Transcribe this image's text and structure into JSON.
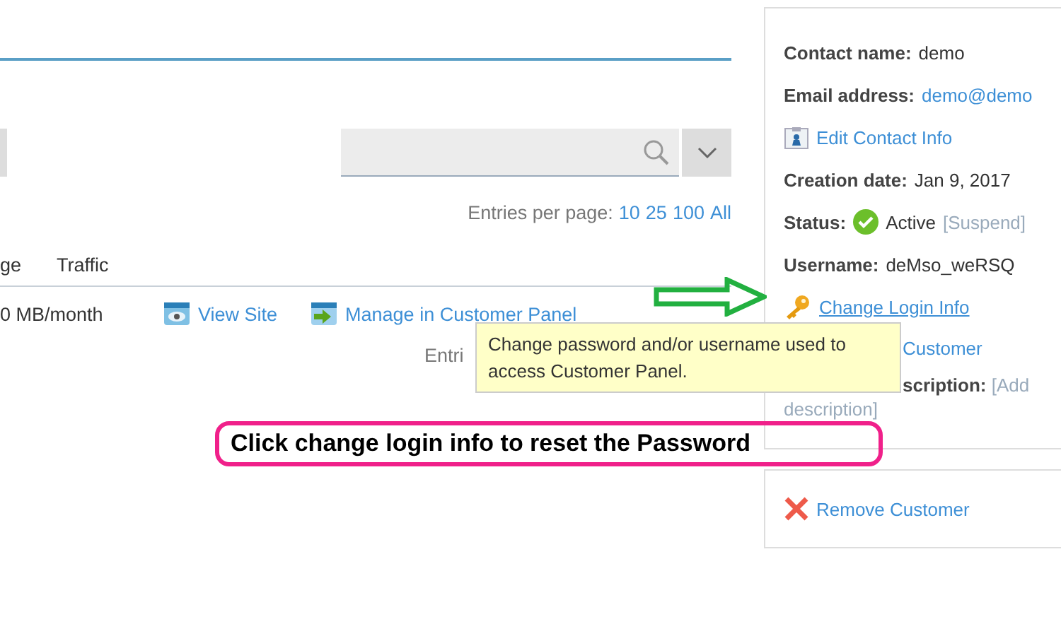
{
  "toolbar": {
    "search": {
      "kind": "search"
    }
  },
  "entries_per_page": {
    "label": "Entries per page:",
    "options": [
      "10",
      "25",
      "100",
      "All"
    ]
  },
  "table": {
    "columns": [
      "ge",
      "Traffic"
    ],
    "rows": [
      {
        "traffic": "0 MB/month",
        "actions": [
          {
            "kind": "view",
            "label": "View Site"
          },
          {
            "kind": "manage",
            "label": "Manage in Customer Panel"
          }
        ]
      }
    ],
    "footer": "Entri"
  },
  "sidebar": {
    "items": [
      {
        "kind": "field",
        "label": "Contact name:",
        "value": "demo"
      },
      {
        "kind": "field",
        "label": "Email address:",
        "link": "demo@demo"
      },
      {
        "kind": "edit",
        "label": "Edit Contact Info"
      },
      {
        "kind": "field",
        "label": "Creation date:",
        "value": "Jan 9, 2017"
      },
      {
        "kind": "status",
        "label": "Status:",
        "value": "Active",
        "link": "[Suspend]"
      },
      {
        "kind": "field",
        "label": "Username:",
        "value": "deMso_weRSQ"
      },
      {
        "kind": "login",
        "label": "Change Login Info"
      },
      {
        "kind": "covered",
        "link": "Customer"
      },
      {
        "kind": "covered",
        "label": "scription:",
        "link": "[Add",
        "link_rest": "description]"
      }
    ],
    "remove": {
      "label": "Remove Customer"
    }
  },
  "tooltip": {
    "text": "Change password and/or username used to access Customer Panel."
  },
  "annotation": {
    "text": "Click change login info to reset the Password"
  }
}
